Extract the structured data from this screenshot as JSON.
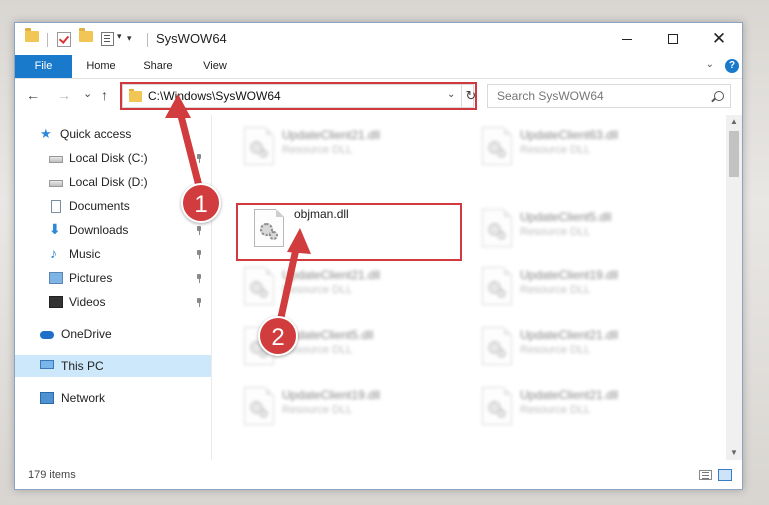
{
  "window": {
    "title": "SysWOW64",
    "controls": {
      "minimize": "minimize",
      "maximize": "maximize",
      "close": "✕"
    }
  },
  "ribbon": {
    "tabs": [
      {
        "label": "File",
        "active": true
      },
      {
        "label": "Home"
      },
      {
        "label": "Share"
      },
      {
        "label": "View"
      }
    ],
    "help": "?"
  },
  "nav": {
    "back": "←",
    "forward": "→",
    "recent": "⌄",
    "up": "↑",
    "address": "C:\\Windows\\SysWOW64",
    "refresh": "↻",
    "search_placeholder": "Search SysWOW64"
  },
  "sidebar": {
    "items": [
      {
        "label": "Quick access",
        "icon": "star-icon",
        "pinned": false
      },
      {
        "label": "Local Disk (C:)",
        "icon": "disk-icon",
        "pinned": true
      },
      {
        "label": "Local Disk (D:)",
        "icon": "disk-icon",
        "pinned": true
      },
      {
        "label": "Documents",
        "icon": "documents-icon",
        "pinned": true
      },
      {
        "label": "Downloads",
        "icon": "download-icon",
        "pinned": true
      },
      {
        "label": "Music",
        "icon": "music-icon",
        "pinned": true
      },
      {
        "label": "Pictures",
        "icon": "pictures-icon",
        "pinned": true
      },
      {
        "label": "Videos",
        "icon": "videos-icon",
        "pinned": true
      },
      {
        "label": "OneDrive",
        "icon": "onedrive-icon",
        "pinned": false
      },
      {
        "label": "This PC",
        "icon": "pc-icon",
        "pinned": false,
        "selected": true
      },
      {
        "label": "Network",
        "icon": "network-icon",
        "pinned": false
      }
    ]
  },
  "files": [
    {
      "name": "UpdateClient21.dll",
      "type": "Resource DLL",
      "blurred": true
    },
    {
      "name": "UpdateClient63.dll",
      "type": "Resource DLL",
      "blurred": true
    },
    {
      "name": "objman.dll",
      "type": "",
      "blurred": false,
      "highlighted": true
    },
    {
      "name": "UpdateClient5.dll",
      "type": "Resource DLL",
      "blurred": true
    },
    {
      "name": "UpdateClient21.dll",
      "type": "Resource DLL",
      "blurred": true
    },
    {
      "name": "UpdateClient19.dll",
      "type": "Resource DLL",
      "blurred": true
    },
    {
      "name": "UpdateClient5.dll",
      "type": "Resource DLL",
      "blurred": true
    },
    {
      "name": "UpdateClient21.dll",
      "type": "Resource DLL",
      "blurred": true
    },
    {
      "name": "UpdateClient19.dll",
      "type": "Resource DLL",
      "blurred": true
    },
    {
      "name": "UpdateClient21.dll",
      "type": "Resource DLL",
      "blurred": true
    }
  ],
  "status": {
    "item_count": "179 items"
  },
  "annotations": {
    "step1": "1",
    "step2": "2",
    "color": "#d13c3e"
  }
}
